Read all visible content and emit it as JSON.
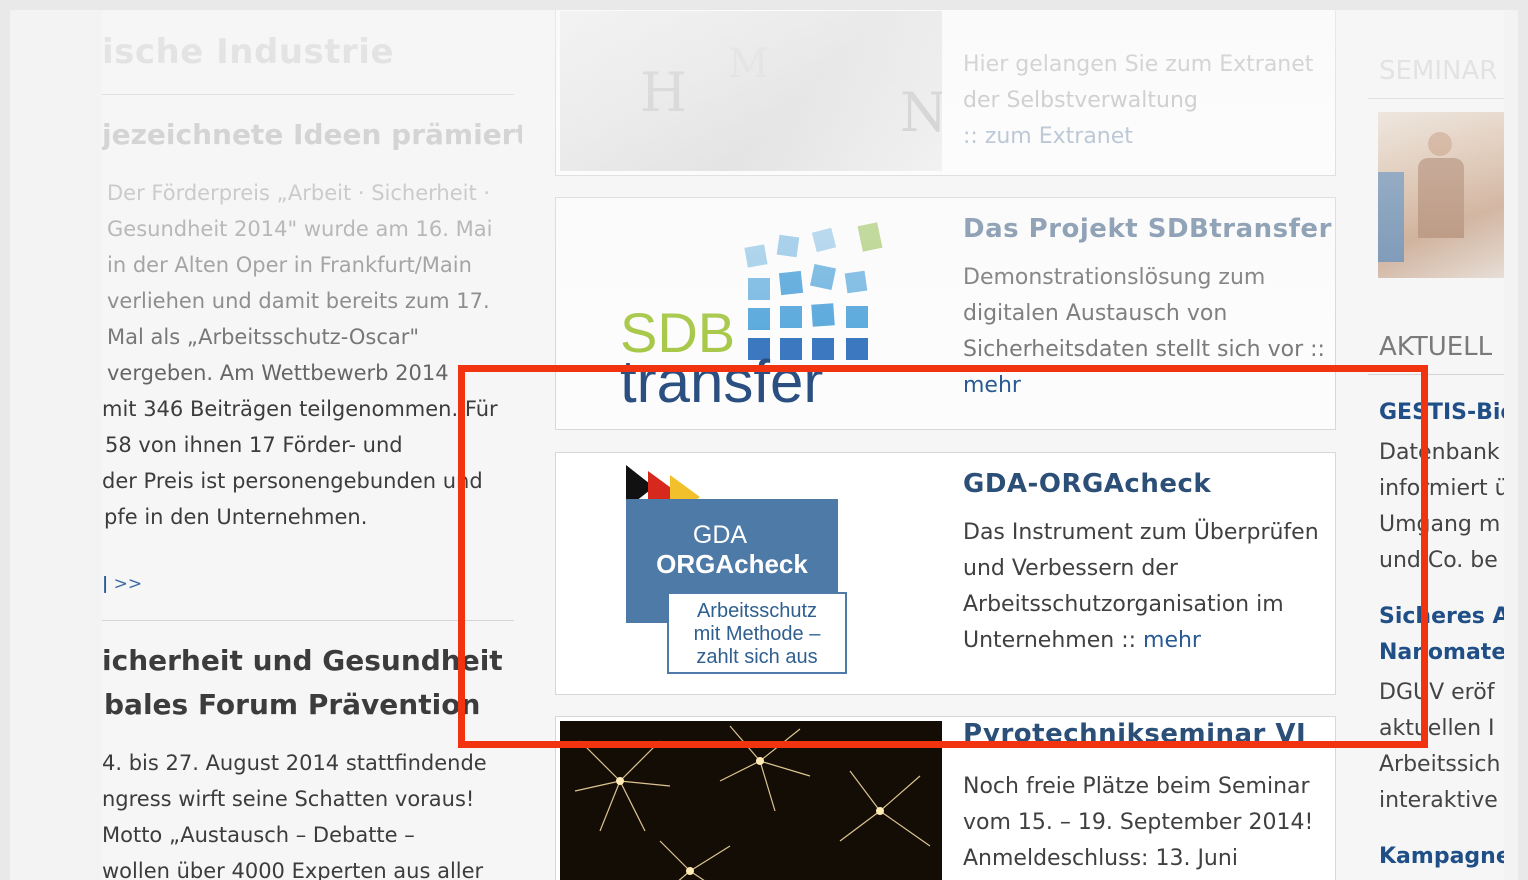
{
  "left": {
    "section_title": "ische Industrie",
    "article1": {
      "title": "jezeichnete Ideen prämiert!",
      "lines": [
        "Der Förderpreis „Arbeit · Sicherheit ·",
        "Gesundheit 2014\" wurde am 16. Mai",
        "in der Alten Oper in Frankfurt/Main",
        "verliehen und damit bereits zum 17.",
        "Mal als „Arbeitsschutz-Oscar\"",
        "vergeben. Am Wettbewerb 2014",
        "mit 346 Beiträgen teilgenommen. Für",
        "58 von ihnen 17 Förder- und",
        "der Preis ist personengebunden und",
        "pfe in den Unternehmen."
      ],
      "more": ">>"
    },
    "article2": {
      "title_lines": [
        "icherheit und Gesundheit",
        "bales Forum Prävention"
      ],
      "lines": [
        "4. bis 27. August 2014 stattfindende",
        "ngress wirft seine Schatten voraus!",
        "Motto „Austausch – Debatte –",
        "wollen über 4000 Experten aus aller"
      ]
    }
  },
  "center": {
    "extranet_card": {
      "lines": [
        "Hier gelangen Sie zum Extranet",
        "der Selbstverwaltung",
        ":: zum Extranet"
      ],
      "image_letters": [
        "H",
        "M",
        "N"
      ]
    },
    "sdb_card": {
      "title": "Das Projekt SDBtransfer",
      "lines": [
        "Demonstrationslösung zum",
        "digitalen Austausch von",
        "Sicherheitsdaten stellt sich vor ::"
      ],
      "link": "mehr",
      "logo_top": "SDB",
      "logo_bottom": "transfer"
    },
    "orga_card": {
      "title": "GDA-ORGAcheck",
      "lines": [
        "Das Instrument zum Überprüfen",
        "und Verbessern der",
        "Arbeitsschutzorganisation im"
      ],
      "last_line_prefix": "Unternehmen :: ",
      "link": "mehr",
      "logo_line1": "GDA",
      "logo_line2": "ORGAcheck",
      "badge_lines": [
        "Arbeitsschutz",
        "mit Methode –",
        "zahlt sich aus"
      ]
    },
    "pyro_card": {
      "title": "Pyrotechnikseminar VI",
      "lines": [
        "Noch freie Plätze beim Seminar",
        "vom 15. – 19. September 2014!",
        "Anmeldeschluss: 13. Juni"
      ]
    }
  },
  "right": {
    "seminar_head": "SEMINAR",
    "aktuell_head": "AKTUELL",
    "items": [
      {
        "title": "GESTIS-Bio",
        "lines": [
          "Datenbank",
          "informiert ü",
          "Umgang m",
          "und Co. be"
        ]
      },
      {
        "title_lines": [
          "Sicheres A",
          "Nanomate"
        ],
        "lines": [
          "DGUV eröf",
          "aktuellen I",
          "Arbeitssich",
          "interaktive"
        ]
      },
      {
        "title": "Kampagne"
      }
    ]
  },
  "colors": {
    "highlight": "#f2330f",
    "link_blue": "#2a5a92",
    "title_blue": "#2c4f78"
  }
}
